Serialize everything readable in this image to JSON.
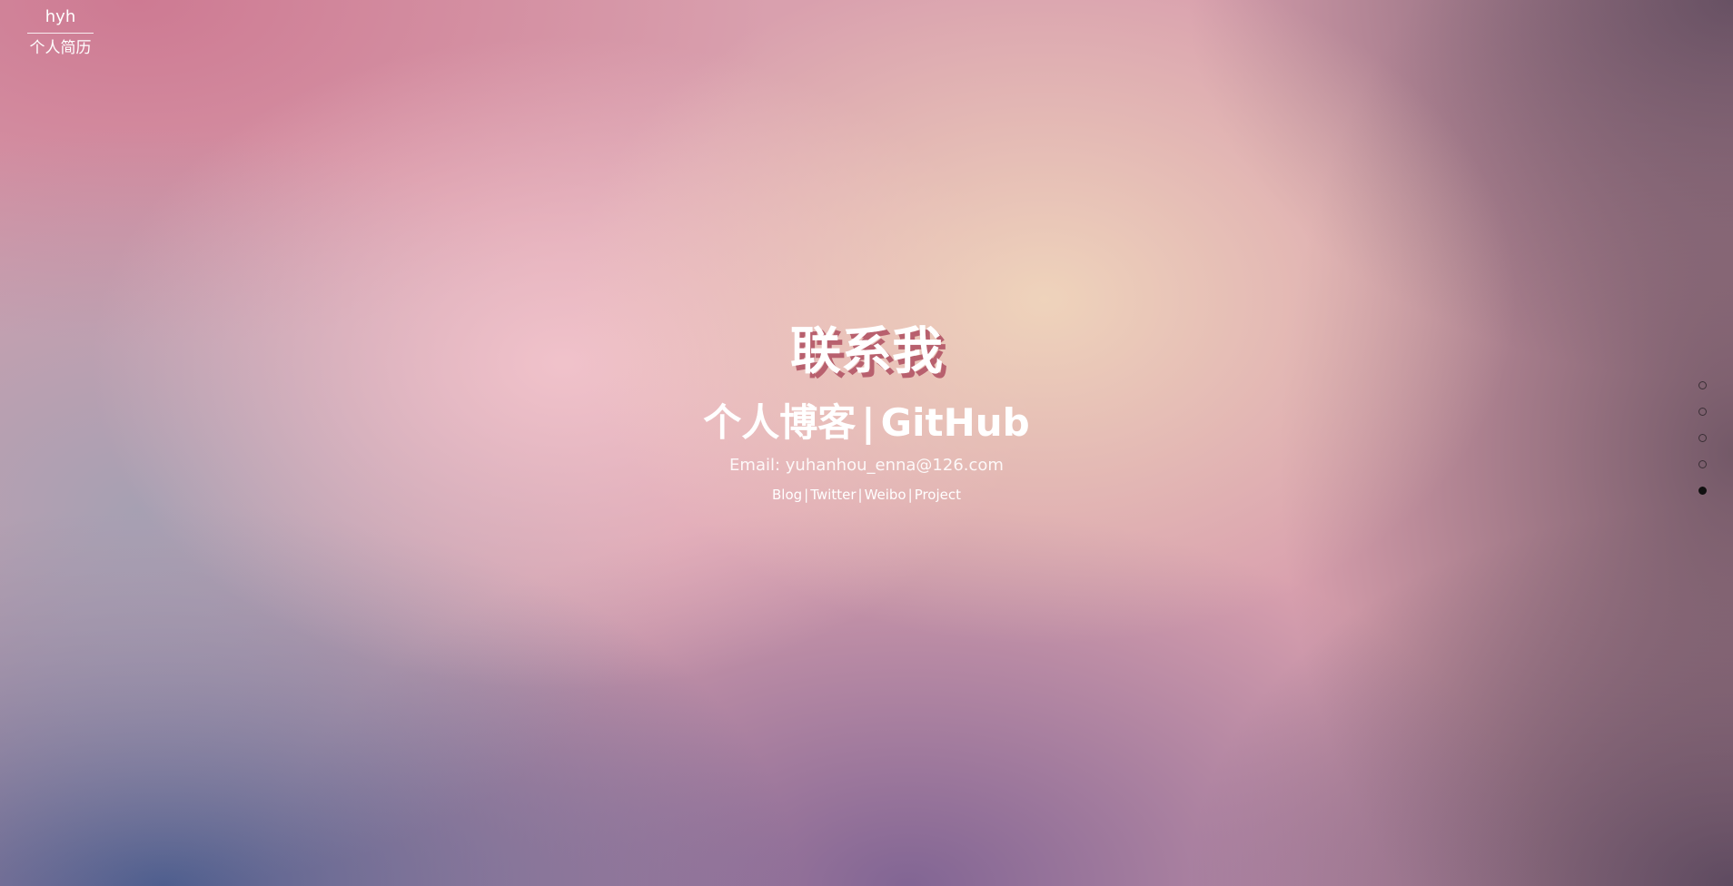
{
  "brand": {
    "name": "hyh",
    "subtitle": "个人简历"
  },
  "contact": {
    "title": "联系我",
    "primary_links": [
      "个人博客",
      "GitHub"
    ],
    "separator": "|",
    "email": "Email: yuhanhou_enna@126.com",
    "secondary_links": [
      "Blog",
      "Twitter",
      "Weibo",
      "Project"
    ]
  },
  "pagination": {
    "count": 5,
    "active_index": 4
  }
}
